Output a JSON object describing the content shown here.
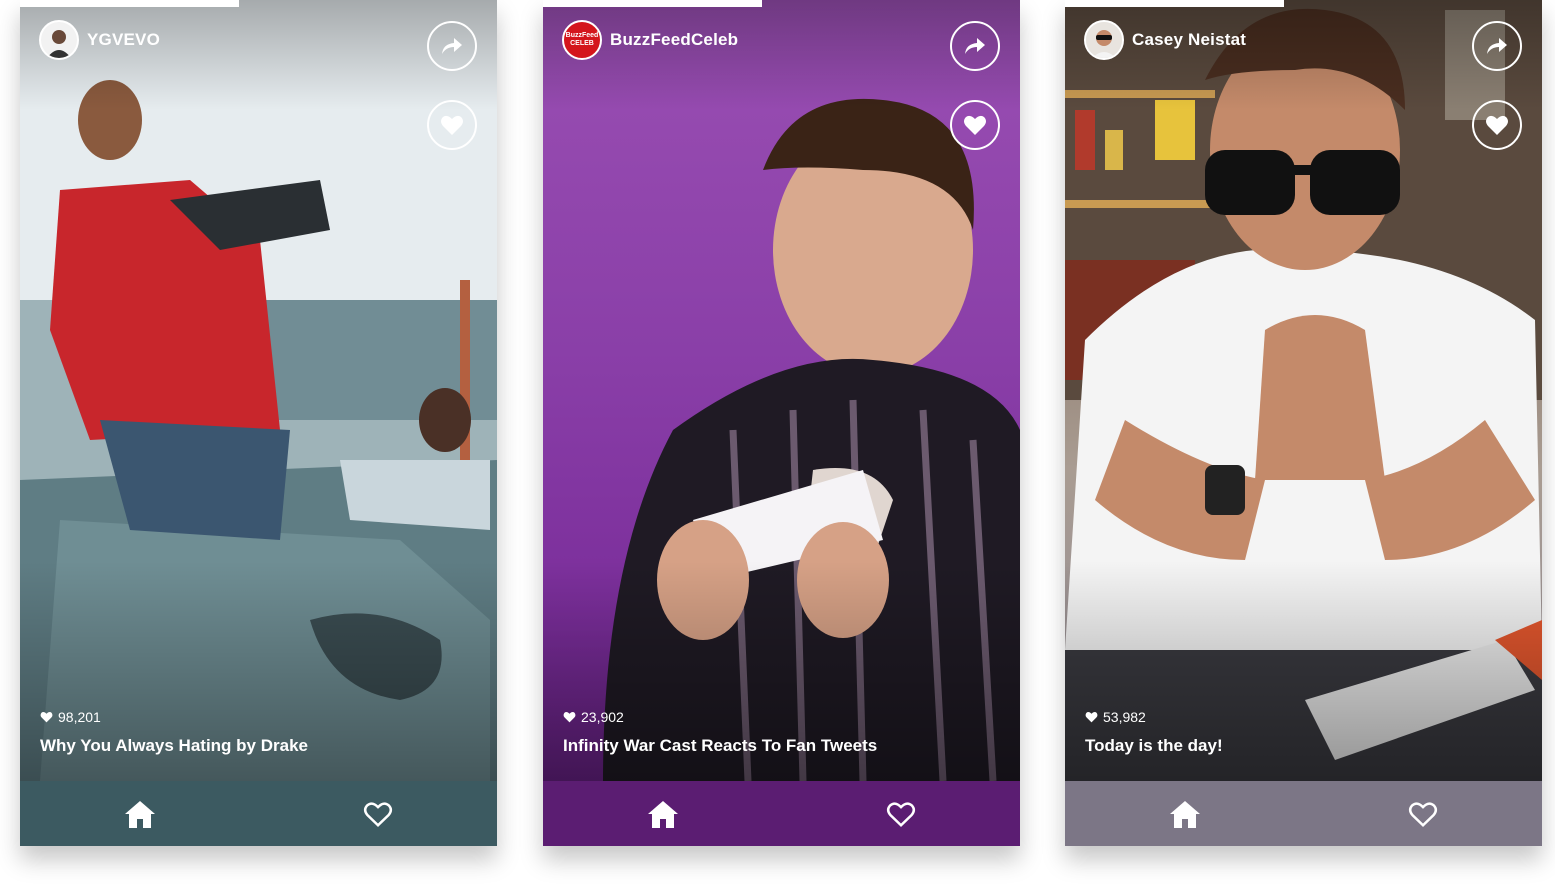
{
  "cards": [
    {
      "channel": "YGVEVO",
      "avatar_icon": "avatar-icon",
      "likes": "98,201",
      "title": "Why You Always Hating  by Drake",
      "accent": "#3c5a61",
      "progress_fraction": 0.46
    },
    {
      "channel": "BuzzFeedCeleb",
      "avatar_text": "BuzzFeed CELEB",
      "likes": "23,902",
      "title": "Infinity War Cast Reacts To Fan Tweets",
      "accent": "#5b1d72",
      "progress_fraction": 0.46
    },
    {
      "channel": "Casey Neistat",
      "avatar_icon": "avatar-icon",
      "likes": "53,982",
      "title": "Today is the day!",
      "accent": "#7c7686",
      "progress_fraction": 0.46
    }
  ],
  "icons": {
    "share": "share-arrow-icon",
    "like": "heart-icon",
    "likes_count": "heart-small-icon",
    "home": "home-icon",
    "favorites": "heart-outline-icon"
  }
}
